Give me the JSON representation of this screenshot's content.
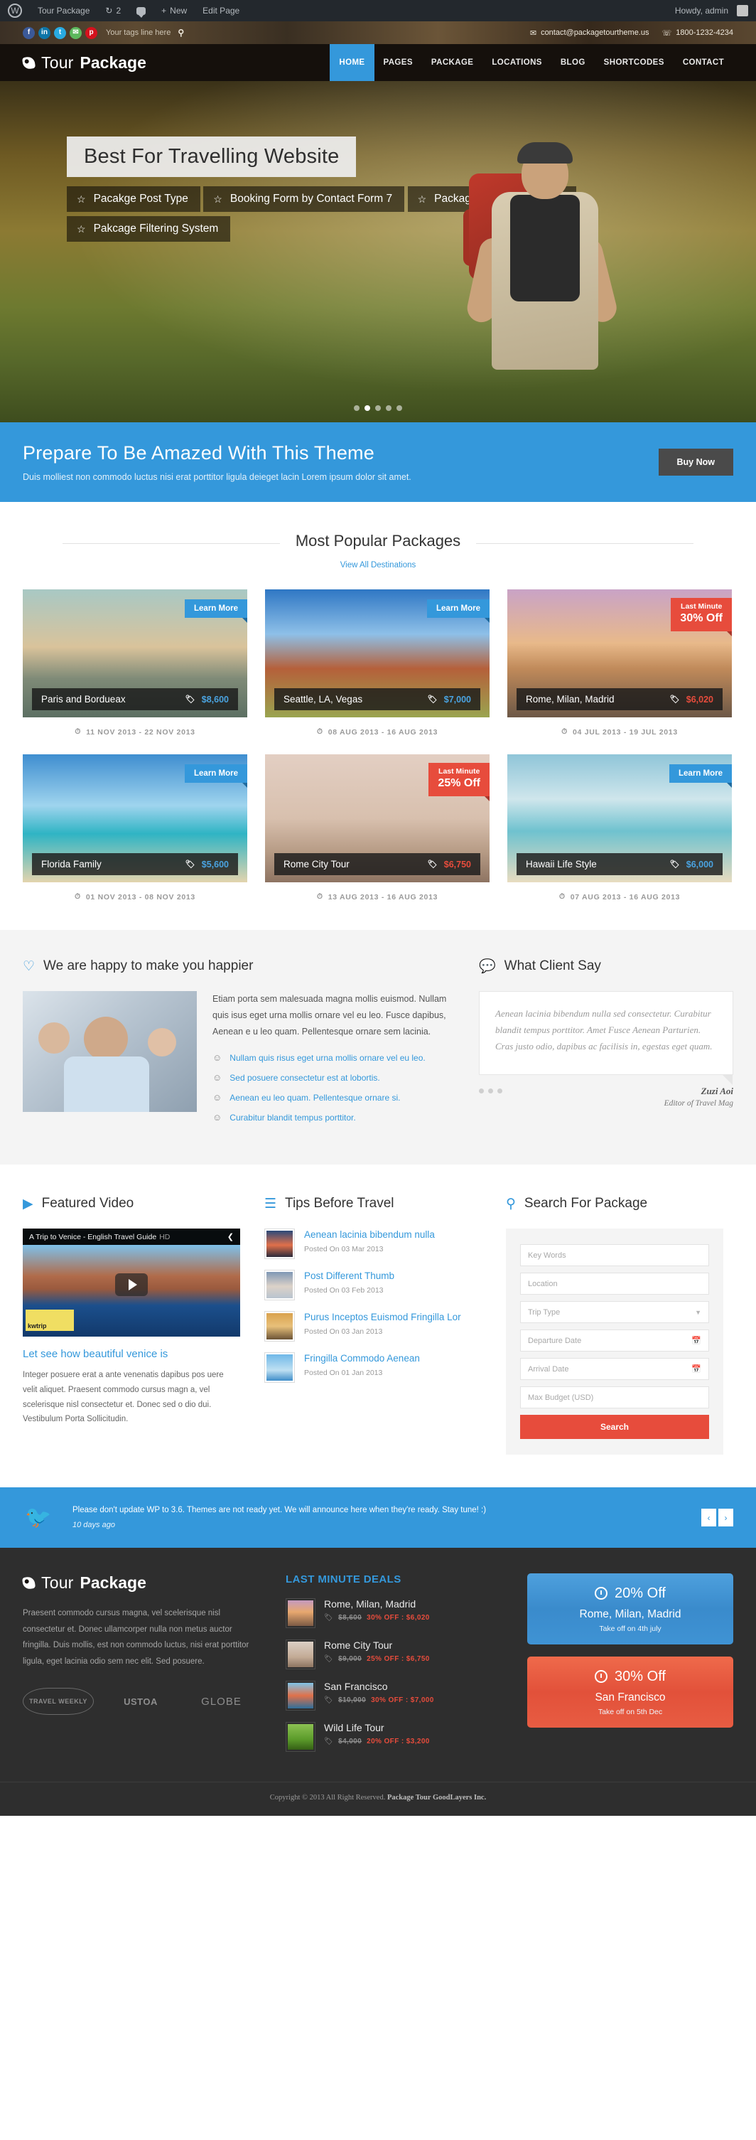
{
  "admin_bar": {
    "logo_icon": "wordpress-icon",
    "site_name": "Tour Package",
    "updates_icon": "updates-icon",
    "updates_count": "2",
    "comments_icon": "comment-bubble-icon",
    "new_icon": "plus-icon",
    "new_label": "New",
    "edit_label": "Edit Page",
    "howdy": "Howdy, admin"
  },
  "topbar": {
    "social": [
      {
        "name": "facebook-icon",
        "glyph": "f"
      },
      {
        "name": "linkedin-icon",
        "glyph": "in"
      },
      {
        "name": "twitter-icon",
        "glyph": "t"
      },
      {
        "name": "email-icon",
        "glyph": "✉"
      },
      {
        "name": "pinterest-icon",
        "glyph": "p"
      }
    ],
    "tagline": "Your tags line here",
    "search_icon": "search-icon",
    "email": "contact@packagetourtheme.us",
    "email_icon": "envelope-icon",
    "phone": "1800-1232-4234",
    "phone_icon": "phone-icon"
  },
  "header": {
    "brand_first": "Tour",
    "brand_second": "Package",
    "nav": [
      {
        "label": "HOME",
        "active": true
      },
      {
        "label": "PAGES",
        "active": false
      },
      {
        "label": "PACKAGE",
        "active": false
      },
      {
        "label": "LOCATIONS",
        "active": false
      },
      {
        "label": "BLOG",
        "active": false
      },
      {
        "label": "SHORTCODES",
        "active": false
      },
      {
        "label": "CONTACT",
        "active": false
      }
    ]
  },
  "hero": {
    "title": "Best For Travelling Website",
    "features": [
      "Pacakge Post Type",
      "Booking Form by Contact Form 7",
      "Package Discount Feature",
      "Pakcage Filtering System"
    ],
    "slide_count": 5,
    "active_slide": 1
  },
  "cta": {
    "title": "Prepare To Be Amazed With This Theme",
    "subtitle": "Duis molliest non commodo luctus nisi erat porttitor ligula deieget lacin Lorem ipsum dolor sit amet.",
    "button": "Buy Now",
    "accent_color": "#3498db"
  },
  "packages": {
    "title": "Most Popular Packages",
    "view_all": "View All Destinations",
    "items": [
      {
        "name": "Paris and Bordueax",
        "price": "$8,600",
        "price_color": "blue",
        "date": "11 NOV 2013 - 22 NOV 2013",
        "badge_type": "learn",
        "badge_label": "Learn More",
        "thumb": "ph-paris"
      },
      {
        "name": "Seattle, LA, Vegas",
        "price": "$7,000",
        "price_color": "blue",
        "date": "08 AUG 2013 - 16 AUG 2013",
        "badge_type": "learn",
        "badge_label": "Learn More",
        "thumb": "ph-seattle"
      },
      {
        "name": "Rome, Milan, Madrid",
        "price": "$6,020",
        "price_color": "red",
        "date": "04 JUL 2013 - 19 JUL 2013",
        "badge_type": "last",
        "badge_top": "Last Minute",
        "badge_bottom": "30% Off",
        "thumb": "ph-rome"
      },
      {
        "name": "Florida Family",
        "price": "$5,600",
        "price_color": "blue",
        "date": "01 NOV 2013 - 08 NOV 2013",
        "badge_type": "learn",
        "badge_label": "Learn More",
        "thumb": "ph-florida"
      },
      {
        "name": "Rome City Tour",
        "price": "$6,750",
        "price_color": "red",
        "date": "13 AUG 2013 - 16 AUG 2013",
        "badge_type": "last",
        "badge_top": "Last Minute",
        "badge_bottom": "25% Off",
        "thumb": "ph-trevi"
      },
      {
        "name": "Hawaii Life Style",
        "price": "$6,000",
        "price_color": "blue",
        "date": "07 AUG 2013 - 16 AUG 2013",
        "badge_type": "learn",
        "badge_label": "Learn More",
        "thumb": "ph-hawaii"
      }
    ]
  },
  "happy": {
    "icon": "heart-icon",
    "title": "We are happy to make you happier",
    "paragraph": "Etiam porta sem malesuada magna mollis euismod. Nullam quis isus eget urna mollis ornare vel eu leo. Fusce dapibus, Aenean e u leo quam. Pellentesque ornare sem lacinia.",
    "bullets": [
      "Nullam quis risus eget urna mollis ornare vel eu leo.",
      "Sed posuere consectetur est at lobortis.",
      "Aenean eu leo quam. Pellentesque ornare si.",
      "Curabitur blandit tempus porttitor."
    ],
    "bullet_icon": "smiley-icon"
  },
  "testimonial": {
    "icon": "speech-bubble-icon",
    "title": "What Client Say",
    "quote": "Aenean lacinia bibendum nulla sed consectetur. Curabitur blandit tempus porttitor. Amet Fusce Aenean Parturien. Cras justo odio, dapibus ac facilisis in, egestas eget quam.",
    "author": "Zuzi Aoi",
    "role": "Editor of Travel Mag",
    "dot_count": 3
  },
  "video": {
    "icon": "video-camera-icon",
    "title": "Featured Video",
    "player_title": "A Trip to Venice - English Travel Guide",
    "player_hd": "HD",
    "share_icon": "share-icon",
    "play_icon": "play-icon",
    "watermark": "kwtrip",
    "caption": "Let see how beautiful venice is",
    "body": "Integer posuere erat a ante venenatis dapibus pos uere velit aliquet. Praesent commodo cursus magn a, vel scelerisque nisl consectetur et. Donec sed o dio dui. Vestibulum Porta Sollicitudin."
  },
  "tips": {
    "icon": "list-icon",
    "title": "Tips Before Travel",
    "items": [
      {
        "title": "Aenean lacinia bibendum nulla",
        "date": "Posted On 03 Mar 2013",
        "thumb": "th-1"
      },
      {
        "title": "Post Different Thumb",
        "date": "Posted On 03 Feb 2013",
        "thumb": "th-2"
      },
      {
        "title": "Purus Inceptos Euismod Fringilla Lor",
        "date": "Posted On 03 Jan 2013",
        "thumb": "th-3"
      },
      {
        "title": "Fringilla Commodo Aenean",
        "date": "Posted On 01 Jan 2013",
        "thumb": "th-4"
      }
    ]
  },
  "search": {
    "icon": "search-icon",
    "title": "Search For Package",
    "keywords_placeholder": "Key Words",
    "location_placeholder": "Location",
    "trip_type_placeholder": "Trip Type",
    "departure_placeholder": "Departure Date",
    "arrival_placeholder": "Arrival Date",
    "budget_placeholder": "Max Budget (USD)",
    "button": "Search",
    "button_color": "#e74c3c",
    "caret_icon": "chevron-down-icon",
    "calendar_icon": "calendar-icon"
  },
  "twitter": {
    "icon": "twitter-bird-icon",
    "tweet": "Please don't update WP to 3.6. Themes are not ready yet. We will announce here when they're ready. Stay tune! :)",
    "ago": "10 days ago",
    "prev_icon": "chevron-left-icon",
    "next_icon": "chevron-right-icon"
  },
  "footer": {
    "brand_first": "Tour",
    "brand_second": "Package",
    "about": "Praesent commodo cursus magna, vel scelerisque nisl consectetur et. Donec ullamcorper nulla non metus auctor fringilla. Duis mollis, est non commodo luctus, nisi erat porttitor ligula, eget lacinia odio sem nec elit. Sed posuere.",
    "awards": [
      {
        "name": "travel-weekly-logo",
        "label": "TRAVEL WEEKLY"
      },
      {
        "name": "ustoa-logo",
        "label": "USTOA"
      },
      {
        "name": "globe-travel-awards-logo",
        "label": "GLOBE"
      }
    ],
    "deals_title": "LAST MINUTE DEALS",
    "deals": [
      {
        "name": "Rome, Milan, Madrid",
        "old": "$8,600",
        "new": "30% OFF : $6,020",
        "thumb": "dth-1"
      },
      {
        "name": "Rome City Tour",
        "old": "$9,000",
        "new": "25% OFF : $6,750",
        "thumb": "dth-2"
      },
      {
        "name": "San Francisco",
        "old": "$10,000",
        "new": "30% OFF : $7,000",
        "thumb": "dth-3"
      },
      {
        "name": "Wild Life Tour",
        "old": "$4,000",
        "new": "20% OFF : $3,200",
        "thumb": "dth-4"
      }
    ],
    "promos": [
      {
        "off": "20% Off",
        "dest": "Rome, Milan, Madrid",
        "take": "Take off on 4th july",
        "color": "blue"
      },
      {
        "off": "30% Off",
        "dest": "San Francisco",
        "take": "Take off on 5th Dec",
        "color": "red"
      }
    ],
    "copyright_pre": "Copyright © 2013 All Right Reserved.",
    "copyright_brand": "Package Tour GoodLayers Inc."
  }
}
